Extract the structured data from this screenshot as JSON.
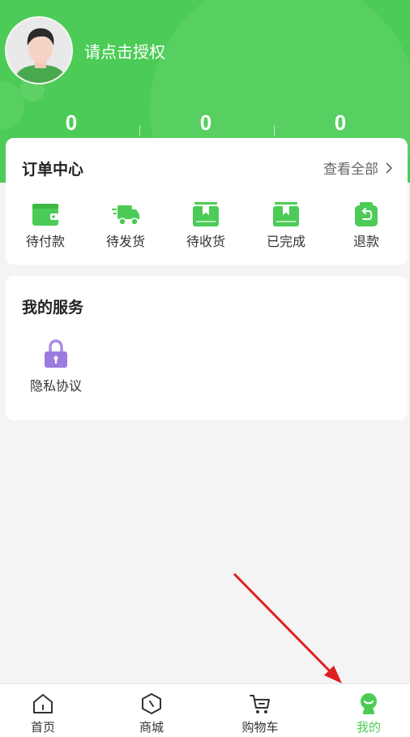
{
  "header": {
    "auth_prompt": "请点击授权",
    "stats": [
      "0",
      "0",
      "0"
    ]
  },
  "order_center": {
    "title": "订单中心",
    "view_all": "查看全部",
    "items": [
      {
        "label": "待付款",
        "icon": "wallet-icon"
      },
      {
        "label": "待发货",
        "icon": "delivery-truck-icon"
      },
      {
        "label": "待收货",
        "icon": "package-box-icon"
      },
      {
        "label": "已完成",
        "icon": "package-box-icon"
      },
      {
        "label": "退款",
        "icon": "refund-bag-icon"
      }
    ]
  },
  "services": {
    "title": "我的服务",
    "items": [
      {
        "label": "隐私协议",
        "icon": "lock-icon"
      }
    ]
  },
  "bottom_nav": {
    "items": [
      {
        "label": "首页",
        "icon": "home-icon"
      },
      {
        "label": "商城",
        "icon": "mall-icon"
      },
      {
        "label": "购物车",
        "icon": "cart-icon"
      },
      {
        "label": "我的",
        "icon": "profile-icon",
        "active": true
      }
    ]
  },
  "colors": {
    "brand_green": "#4ccc56",
    "service_icon": "#9b7be0",
    "annotation_arrow": "#e02020"
  }
}
